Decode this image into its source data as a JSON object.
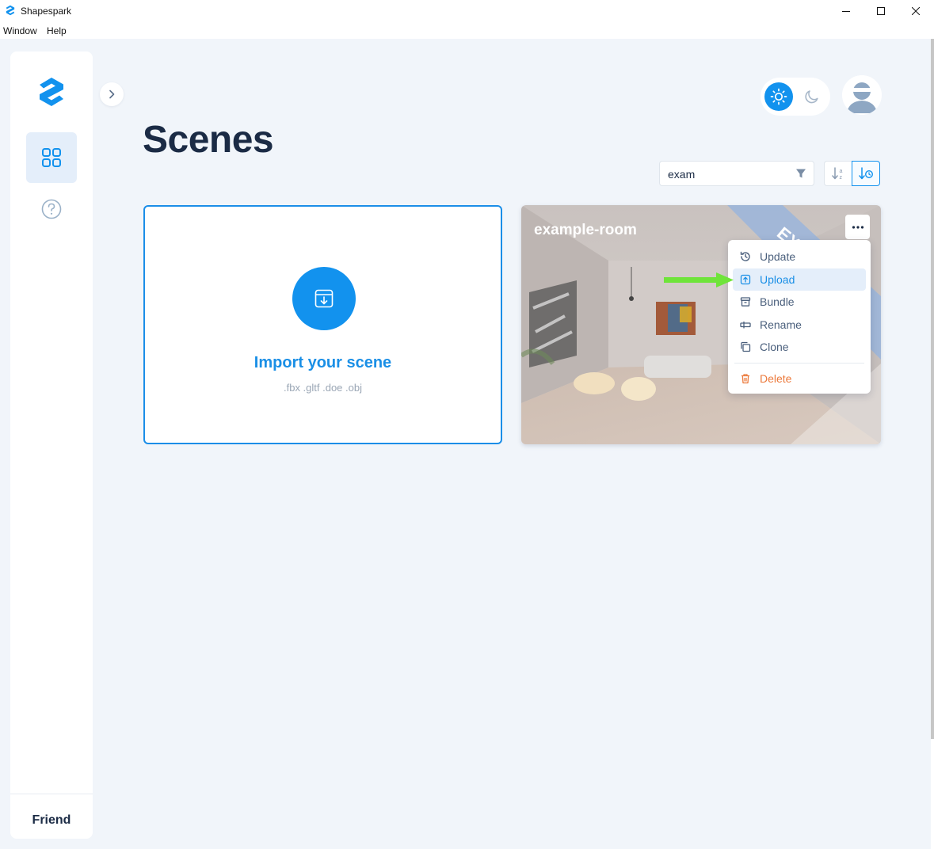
{
  "window": {
    "title": "Shapespark",
    "menu": [
      "Window",
      "Help"
    ]
  },
  "sidebar": {
    "user_name": "Friend",
    "nav": [
      {
        "name": "scenes",
        "icon": "grid-icon",
        "active": true
      },
      {
        "name": "help",
        "icon": "help-circle-icon",
        "active": false
      }
    ]
  },
  "header": {
    "page_title": "Scenes",
    "theme": "light"
  },
  "toolbar": {
    "search_value": "exam",
    "sort_options": [
      "sort-alpha-icon",
      "sort-recent-icon"
    ],
    "active_sort": "sort-recent-icon"
  },
  "import_card": {
    "title": "Import your scene",
    "formats": ".fbx .gltf .doe .obj"
  },
  "scene": {
    "name": "example-room",
    "badge_fragment": "EX"
  },
  "context_menu": {
    "items": [
      {
        "label": "Update",
        "icon": "history-icon"
      },
      {
        "label": "Upload",
        "icon": "upload-icon",
        "highlighted": true
      },
      {
        "label": "Bundle",
        "icon": "archive-icon"
      },
      {
        "label": "Rename",
        "icon": "rename-icon"
      },
      {
        "label": "Clone",
        "icon": "copy-icon"
      },
      {
        "label": "Delete",
        "icon": "trash-icon",
        "danger": true
      }
    ]
  },
  "colors": {
    "accent": "#1292ee",
    "danger": "#ec7a3c",
    "annotation": "#6fe43a",
    "background": "#f1f5fa"
  }
}
